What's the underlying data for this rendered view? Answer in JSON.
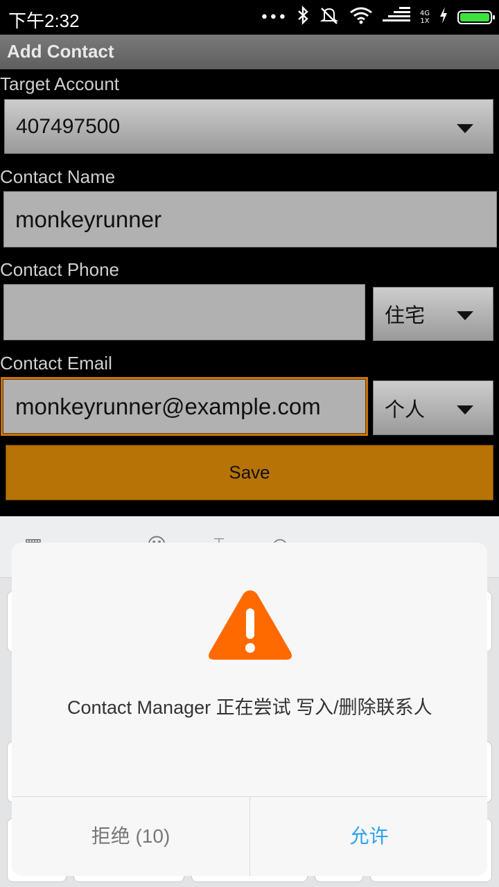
{
  "status_bar": {
    "time": "下午2:32",
    "icons": [
      "more-dots-icon",
      "bluetooth-icon",
      "mute-icon",
      "wifi-icon",
      "signal-icon",
      "charging-icon",
      "battery-icon"
    ],
    "network": "4G",
    "network_sub": "1X"
  },
  "app": {
    "title": "Add Contact"
  },
  "form": {
    "target_account_label": "Target Account",
    "target_account_value": "407497500",
    "contact_name_label": "Contact Name",
    "contact_name_value": "monkeyrunner",
    "contact_phone_label": "Contact Phone",
    "contact_phone_value": "",
    "phone_type": "住宅",
    "contact_email_label": "Contact Email",
    "contact_email_value": "monkeyrunner@example.com",
    "email_type": "个人",
    "save_label": "Save"
  },
  "dialog": {
    "message": "Contact Manager 正在尝试 写入/删除联系人",
    "deny_label": "拒绝 (10)",
    "allow_label": "允许",
    "warning_color": "#ff6a00",
    "allow_color": "#2aa3ee"
  },
  "colors": {
    "save_button": "#b87306",
    "focus_border": "#c8730e"
  }
}
